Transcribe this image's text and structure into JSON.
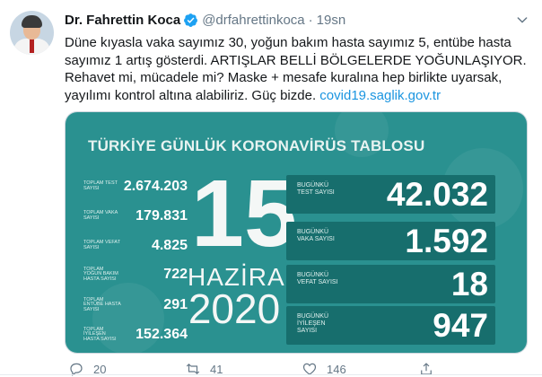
{
  "tweet": {
    "author_name": "Dr. Fahrettin Koca",
    "handle": "@drfahrettinkoca",
    "separator": "·",
    "time": "19sn",
    "text_main": "Düne kıyasla vaka sayımız 30, yoğun bakım hasta sayımız 5, entübe hasta sayımız 1 artış gösterdi. ARTIŞLAR BELLİ BÖLGELERDE YOĞUNLAŞIYOR. Rehavet mi, mücadele mi? Maske + mesafe kuralına hep birlikte uyarsak, yayılımı kontrol altına alabiliriz. Güç bizde.",
    "link": "covid19.saglik.gov.tr"
  },
  "poster": {
    "title": "TÜRKİYE GÜNLÜK KORONAVİRÜS TABLOSU",
    "day": "15",
    "month": "HAZİRAN",
    "year": "2020",
    "totals": [
      {
        "label": "TOPLAM TEST SAYISI",
        "value": "2.674.203"
      },
      {
        "label": "TOPLAM VAKA SAYISI",
        "value": "179.831"
      },
      {
        "label": "TOPLAM VEFAT SAYISI",
        "value": "4.825"
      },
      {
        "label": "TOPLAM YOĞUN BAKIM HASTA SAYISI",
        "value": "722"
      },
      {
        "label": "TOPLAM ENTÜBE HASTA SAYISI",
        "value": "291"
      },
      {
        "label": "TOPLAM İYİLEŞEN HASTA SAYISI",
        "value": "152.364"
      }
    ],
    "today": [
      {
        "label": "BUGÜNKÜ TEST SAYISI",
        "value": "42.032"
      },
      {
        "label": "BUGÜNKÜ VAKA SAYISI",
        "value": "1.592"
      },
      {
        "label": "BUGÜNKÜ VEFAT SAYISI",
        "value": "18"
      },
      {
        "label": "BUGÜNKÜ İYİLEŞEN SAYISI",
        "value": "947"
      }
    ]
  },
  "actions": {
    "reply_count": "20",
    "retweet_count": "41",
    "like_count": "146"
  },
  "colors": {
    "poster_bg": "#2a9190",
    "box_bg": "#176e6d",
    "link": "#1b95e0",
    "verified": "#1da1f2"
  },
  "icons": {
    "verified": "verified-badge-icon",
    "caret": "chevron-down-icon",
    "reply": "reply-icon",
    "retweet": "retweet-icon",
    "like": "heart-icon",
    "share": "share-icon"
  }
}
